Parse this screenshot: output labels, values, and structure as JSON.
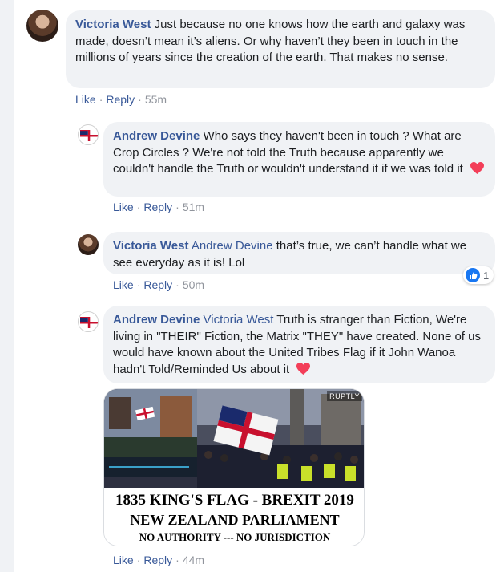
{
  "comments": [
    {
      "author": "Victoria West",
      "text": "Just because no one knows how the earth and galaxy was made, doesn’t mean it’s aliens. Or why haven’t they been in touch in the millions of years since the creation of the earth. That makes no sense.",
      "like_label": "Like",
      "reply_label": "Reply",
      "time": "55m"
    },
    {
      "author": "Andrew Devine",
      "text": "Who says they haven't been in touch ? What are Crop Circles ? We're not told the Truth because apparently we couldn't handle the Truth or wouldn't understand it if we was told it",
      "like_label": "Like",
      "reply_label": "Reply",
      "time": "51m"
    },
    {
      "author": "Victoria West",
      "tag": "Andrew Devine",
      "text": "that’s true, we can’t handle what we see everyday as it is! Lol",
      "like_label": "Like",
      "reply_label": "Reply",
      "time": "50m",
      "reaction_count": "1"
    },
    {
      "author": "Andrew Devine",
      "tag": "Victoria West",
      "text": "Truth is stranger than Fiction, We're living in \"THEIR\" Fiction, the Matrix \"THEY\" have created. None of us would have known about the United Tribes Flag if it John Wanoa hadn't Told/Reminded Us about it",
      "like_label": "Like",
      "reply_label": "Reply",
      "time": "44m"
    }
  ],
  "attachment": {
    "caption_line1": "1835 KING'S FLAG - BREXIT 2019",
    "caption_line2": "NEW ZEALAND PARLIAMENT",
    "caption_line3": "NO AUTHORITY --- NO JURISDICTION",
    "watermark": "RUPTLY"
  },
  "colors": {
    "link": "#385898",
    "bubble": "#f0f2f5",
    "meta": "#90949c",
    "heart": "#f33e58",
    "like_blue": "#1877f2"
  }
}
